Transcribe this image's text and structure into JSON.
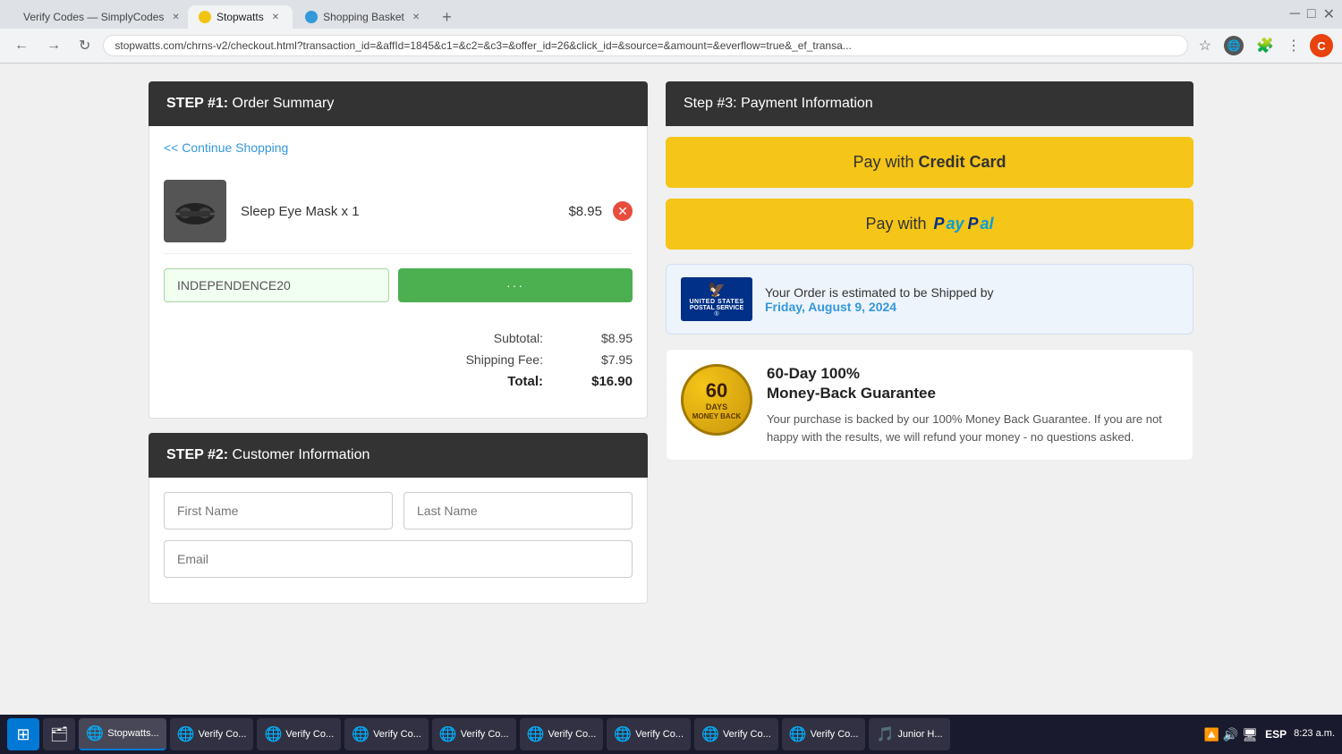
{
  "browser": {
    "tabs": [
      {
        "id": "tab1",
        "label": "Verify Codes — SimplyCodes",
        "icon": "green",
        "active": false
      },
      {
        "id": "tab2",
        "label": "Stopwatts",
        "icon": "yellow",
        "active": true
      },
      {
        "id": "tab3",
        "label": "Shopping Basket",
        "icon": "blue",
        "active": false
      }
    ],
    "address": "stopwatts.com/chrns-v2/checkout.html?transaction_id=&affId=1845&c1=&c2=&c3=&offer_id=26&click_id=&source=&amount=&everflow=true&_ef_transa...",
    "new_tab_label": "+"
  },
  "left": {
    "step1_label": "STEP #1:",
    "step1_title": "Order Summary",
    "continue_shopping": "<< Continue Shopping",
    "product": {
      "name": "Sleep Eye Mask x 1",
      "price": "$8.95"
    },
    "coupon": {
      "value": "INDEPENDENCE20",
      "placeholder": "INDEPENDENCE20",
      "apply_dots": "···"
    },
    "subtotal_label": "Subtotal:",
    "subtotal_value": "$8.95",
    "shipping_label": "Shipping Fee:",
    "shipping_value": "$7.95",
    "total_label": "Total:",
    "total_value": "$16.90",
    "step2_label": "STEP #2:",
    "step2_title": "Customer Information",
    "first_name_placeholder": "First Name",
    "last_name_placeholder": "Last Name",
    "email_placeholder": "Email"
  },
  "right": {
    "step3_label": "Step #3:",
    "step3_title": "Payment Information",
    "pay_credit_label": "Pay with",
    "pay_credit_bold": "Credit Card",
    "pay_paypal_label": "Pay with",
    "shipping_estimate_label": "Your Order is estimated to be Shipped by",
    "shipping_date": "Friday, August 9, 2024",
    "usps_label": "UNITED STATES POSTAL SERVICE®",
    "guarantee_days": "60",
    "guarantee_days_sub": "DAYS",
    "guarantee_money": "MONEY BACK",
    "guarantee_title": "60-Day 100%\nMoney-Back Guarantee",
    "guarantee_text": "Your purchase is backed by our 100% Money Back Guarantee. If you are not happy with the results, we will refund your money - no questions asked."
  },
  "taskbar": {
    "start_icon": "⊞",
    "apps": [
      {
        "id": "app1",
        "icon": "🗂",
        "label": ""
      },
      {
        "id": "app2",
        "icon": "🌐",
        "label": "Stopwatts..."
      },
      {
        "id": "app3",
        "icon": "🌐",
        "label": "Verify Co..."
      },
      {
        "id": "app4",
        "icon": "🌐",
        "label": "Verify Co..."
      },
      {
        "id": "app5",
        "icon": "🌐",
        "label": "Verify Co..."
      },
      {
        "id": "app6",
        "icon": "🌐",
        "label": "Verify Co..."
      },
      {
        "id": "app7",
        "icon": "🌐",
        "label": "Verify Co..."
      },
      {
        "id": "app8",
        "icon": "🌐",
        "label": "Verify Co..."
      },
      {
        "id": "app9",
        "icon": "🌐",
        "label": "Verify Co..."
      },
      {
        "id": "app10",
        "icon": "🌐",
        "label": "Verify Co..."
      },
      {
        "id": "app11",
        "icon": "🌐",
        "label": "Verify Co..."
      },
      {
        "id": "app12",
        "icon": "🎵",
        "label": "Junior H..."
      }
    ],
    "tray": {
      "keyboard_lang": "ESP",
      "time": "8:23 a.m.",
      "tray_icons": [
        "🔼",
        "🔊",
        "🖥"
      ]
    }
  }
}
